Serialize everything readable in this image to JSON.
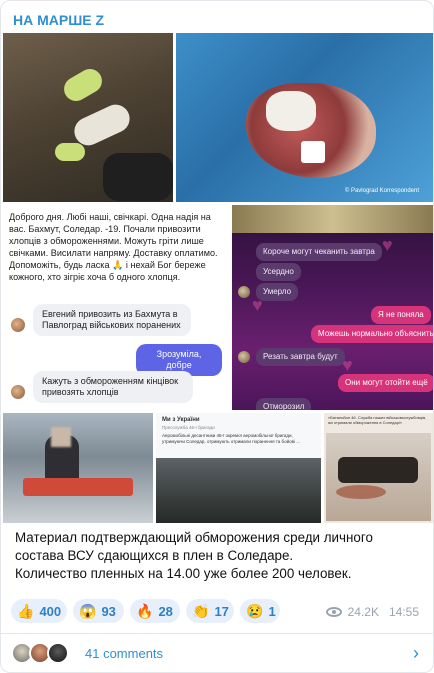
{
  "channel": {
    "name": "НА МАРШЕ Z"
  },
  "screenshot_ua": {
    "text": "Доброго дня. Любі наші, свічкарі. Одна надія на вас. Бахмут, Соледар. -19. Почали привозити хлопців з обмороженнями. Можуть гріти лише свічками. Висилати напряму. Доставку оплатимо. Допоможіть, будь ласка 🙏 і нехай Бог береже кожного, хто зігріє хоча б одного хлопця.",
    "msg1": "Евгений привозить из Бахмута в Павлоград військових поранених",
    "reply": "Зрозуміла, добре",
    "msg2": "Кажуть з обмороженням кінцівок привозять хлопців"
  },
  "screenshot_ru": {
    "m1": "Короче могут чеканить завтра",
    "m2": "Усердно",
    "m3": "Умерло",
    "m4": "Я не поняла",
    "m5": "Можешь нормально объяснить",
    "m6": "Резать завтра будут",
    "m7": "Они могут отойти ещё",
    "m8": "Отморозил"
  },
  "screenshot_post": {
    "header": "Ми з України",
    "subline": "Пресслужба 46-ї бригади",
    "body": "Аеромобільні десантники 46-ї окремої аеромобільної бригади, утримуючи Соледар, отримують отримали поранення та бойові ..."
  },
  "screenshot_news": {
    "text": "«Батальйон 46. Служба наших військовослужбовців, які отримали обмороження в Соледарі»"
  },
  "photo_watermark": "© Pavlograd Korrespondent",
  "caption": {
    "line1": "Материал подтверждающий обморожения среди личного состава ВСУ сдающихся в плен в Соледаре.",
    "line2": "Количество пленных на 14.00 уже более 200 человек."
  },
  "reactions": [
    {
      "emoji": "👍",
      "count": "400"
    },
    {
      "emoji": "😱",
      "count": "93"
    },
    {
      "emoji": "🔥",
      "count": "28"
    },
    {
      "emoji": "👏",
      "count": "17"
    },
    {
      "emoji": "😢",
      "count": "1"
    }
  ],
  "meta": {
    "views": "24.2K",
    "time": "14:55",
    "views_icon": "eye-icon"
  },
  "comments": {
    "label": "41 comments",
    "chevron_icon": "chevron-right-icon"
  },
  "colors": {
    "accent": "#2f8fd1",
    "reaction_bg": "#e7f0fa",
    "purple_chat": "#4a1757",
    "pink_bubble": "#d6337b"
  }
}
